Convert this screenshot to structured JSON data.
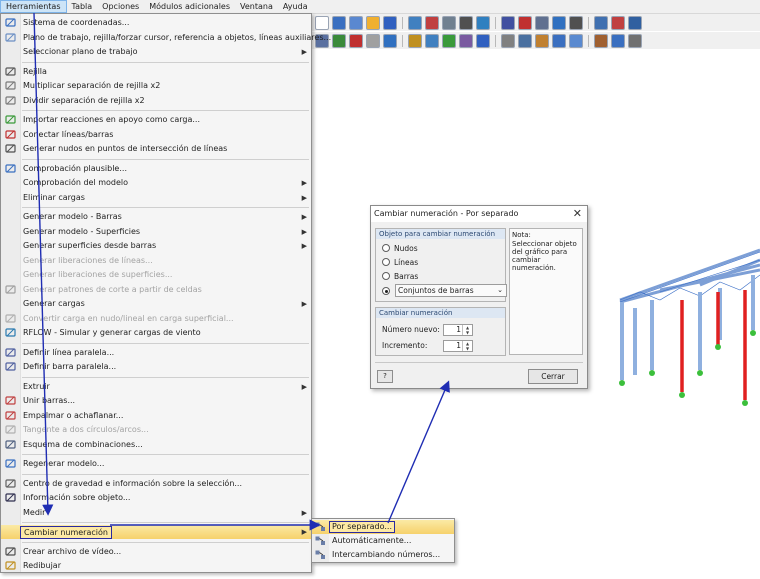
{
  "menubar": {
    "items": [
      {
        "label": "Herramientas",
        "active": true
      },
      {
        "label": "Tabla"
      },
      {
        "label": "Opciones"
      },
      {
        "label": "Módulos adicionales"
      },
      {
        "label": "Ventana"
      },
      {
        "label": "Ayuda"
      }
    ]
  },
  "menu": {
    "items": [
      {
        "label": "Sistema de coordenadas...",
        "icon": "coordinate-system-icon"
      },
      {
        "label": "Plano de trabajo, rejilla/forzar cursor, referencia a objetos, líneas auxiliares...",
        "icon": "work-plane-icon"
      },
      {
        "label": "Seleccionar plano de trabajo",
        "icon": "",
        "submenu": true
      },
      {
        "label": "Rejilla",
        "icon": "grid-icon"
      },
      {
        "label": "Multiplicar separación de rejilla x2",
        "icon": "grid-multiply-icon"
      },
      {
        "label": "Dividir separación de rejilla x2",
        "icon": "grid-divide-icon"
      },
      {
        "label": "Importar reacciones en apoyo como carga...",
        "icon": "import-reactions-icon"
      },
      {
        "label": "Conectar líneas/barras",
        "icon": "connect-lines-icon"
      },
      {
        "label": "Generar nudos en puntos de intersección de líneas",
        "icon": "intersection-nodes-icon"
      },
      {
        "label": "Comprobación plausible...",
        "icon": "plausibility-check-icon"
      },
      {
        "label": "Comprobación del modelo",
        "icon": "",
        "submenu": true
      },
      {
        "label": "Eliminar cargas",
        "icon": "",
        "submenu": true
      },
      {
        "label": "Generar modelo - Barras",
        "icon": "",
        "submenu": true
      },
      {
        "label": "Generar modelo - Superficies",
        "icon": "",
        "submenu": true
      },
      {
        "label": "Generar superficies desde barras",
        "icon": "",
        "submenu": true
      },
      {
        "label": "Generar liberaciones de líneas...",
        "icon": "",
        "disabled": true
      },
      {
        "label": "Generar liberaciones de superficies...",
        "icon": "",
        "disabled": true
      },
      {
        "label": "Generar patrones de corte a partir de celdas",
        "icon": "cutting-pattern-icon",
        "disabled": true
      },
      {
        "label": "Generar cargas",
        "icon": "",
        "submenu": true
      },
      {
        "label": "Convertir carga en nudo/lineal en carga superficial...",
        "icon": "convert-load-icon",
        "disabled": true
      },
      {
        "label": "RFLOW - Simular y generar cargas de viento",
        "icon": "rwind-icon"
      },
      {
        "label": "Definir línea paralela...",
        "icon": "parallel-line-icon"
      },
      {
        "label": "Definir barra paralela...",
        "icon": "parallel-member-icon"
      },
      {
        "label": "Extruir",
        "icon": "",
        "submenu": true
      },
      {
        "label": "Unir barras...",
        "icon": "join-members-icon"
      },
      {
        "label": "Empalmar o achaflanar...",
        "icon": "fillet-icon"
      },
      {
        "label": "Tangente a dos círculos/arcos...",
        "icon": "tangent-icon",
        "disabled": true
      },
      {
        "label": "Esquema de combinaciones...",
        "icon": "combination-scheme-icon"
      },
      {
        "label": "Regenerar modelo...",
        "icon": "regenerate-model-icon"
      },
      {
        "label": "Centro de gravedad e información sobre la selección...",
        "icon": "center-of-gravity-icon"
      },
      {
        "label": "Información sobre objeto...",
        "icon": "object-info-icon"
      },
      {
        "label": "Medir",
        "icon": "",
        "submenu": true
      },
      {
        "label": "Cambiar numeración",
        "icon": "",
        "submenu": true,
        "highlight": true
      },
      {
        "label": "Crear archivo de vídeo...",
        "icon": "video-file-icon"
      },
      {
        "label": "Redibujar",
        "icon": "redraw-icon"
      }
    ]
  },
  "submenu": {
    "items": [
      {
        "label": "Por separado...",
        "highlight": true
      },
      {
        "label": "Automáticamente..."
      },
      {
        "label": "Intercambiando números..."
      }
    ]
  },
  "dialog": {
    "title": "Cambiar numeración - Por separado",
    "object_group": "Objeto para cambiar numeración",
    "options": [
      "Nudos",
      "Líneas",
      "Barras"
    ],
    "combo_value": "Conjuntos de barras",
    "renum_group": "Cambiar numeración",
    "new_number_label": "Número nuevo:",
    "new_number_value": "1",
    "increment_label": "Incremento:",
    "increment_value": "1",
    "note_title": "Nota:",
    "note_body": "Seleccionar objeto del gráfico para cambiar numeración.",
    "close_button": "Cerrar"
  },
  "colors": {
    "highlight": "#f6d16c",
    "arrow": "#1f2db3",
    "support_green": "#3bbf3b",
    "member_red": "#e02020",
    "member_blue": "#7d9fd6"
  }
}
